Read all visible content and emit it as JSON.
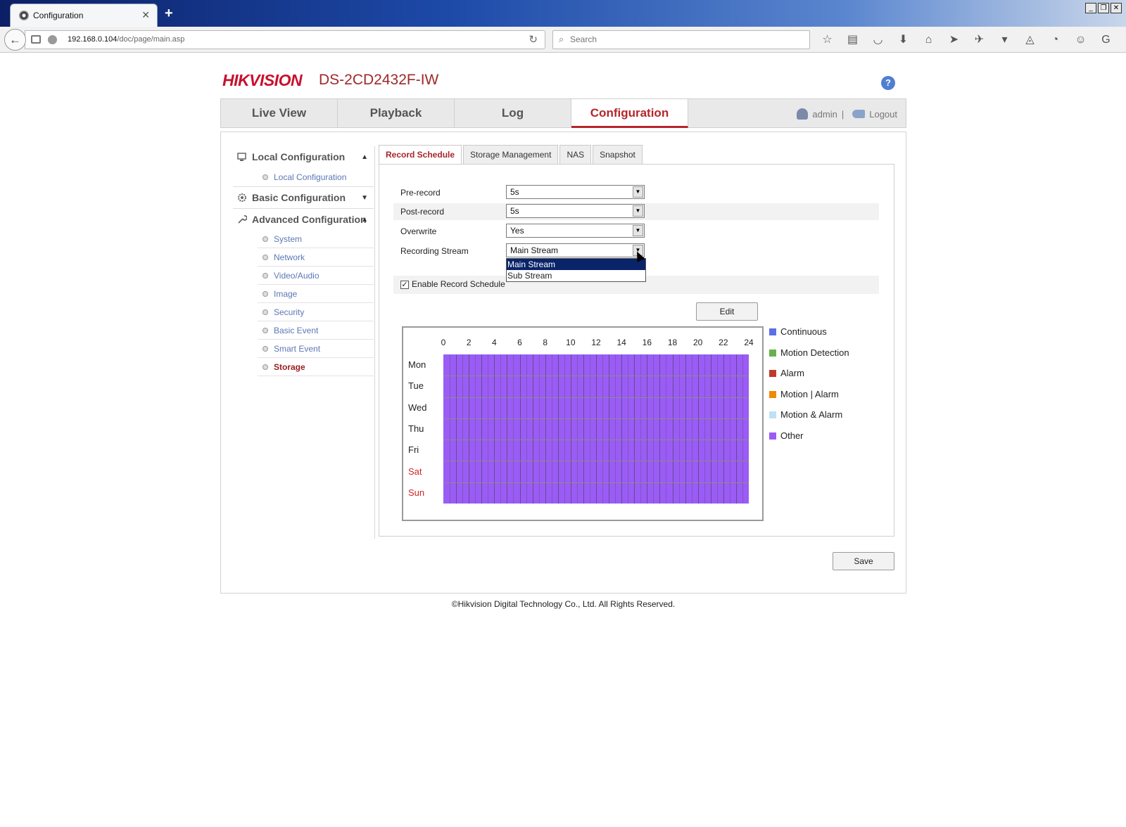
{
  "browser": {
    "tab_title": "Configuration",
    "url_host": "192.168.0.104",
    "url_path": "/doc/page/main.asp",
    "search_placeholder": "Search"
  },
  "app": {
    "logo": "HIKVISION",
    "model": "DS-2CD2432F-IW",
    "help_label": "?"
  },
  "main_nav": {
    "tabs": [
      {
        "label": "Live View"
      },
      {
        "label": "Playback"
      },
      {
        "label": "Log"
      },
      {
        "label": "Configuration",
        "active": true
      }
    ],
    "user": "admin",
    "separator": "|",
    "logout": "Logout"
  },
  "sidebar": {
    "local_group": "Local Configuration",
    "local_items": [
      {
        "label": "Local Configuration"
      }
    ],
    "basic_group": "Basic Configuration",
    "advanced_group": "Advanced Configuration",
    "advanced_items": [
      {
        "label": "System"
      },
      {
        "label": "Network"
      },
      {
        "label": "Video/Audio"
      },
      {
        "label": "Image"
      },
      {
        "label": "Security"
      },
      {
        "label": "Basic Event"
      },
      {
        "label": "Smart Event"
      },
      {
        "label": "Storage",
        "active": true
      }
    ]
  },
  "sub_tabs": [
    {
      "label": "Record Schedule",
      "active": true
    },
    {
      "label": "Storage Management"
    },
    {
      "label": "NAS"
    },
    {
      "label": "Snapshot"
    }
  ],
  "form": {
    "pre_record_label": "Pre-record",
    "pre_record_value": "5s",
    "post_record_label": "Post-record",
    "post_record_value": "5s",
    "overwrite_label": "Overwrite",
    "overwrite_value": "Yes",
    "recording_stream_label": "Recording Stream",
    "recording_stream_value": "Main Stream",
    "recording_stream_options": [
      "Main Stream",
      "Sub Stream"
    ],
    "enable_record_schedule_label": "Enable Record Schedule",
    "enable_record_schedule_checked": true,
    "edit_label": "Edit",
    "save_label": "Save"
  },
  "schedule": {
    "hours": [
      "0",
      "2",
      "4",
      "6",
      "8",
      "10",
      "12",
      "14",
      "16",
      "18",
      "20",
      "22",
      "24"
    ],
    "days": [
      {
        "label": "Mon",
        "weekend": false
      },
      {
        "label": "Tue",
        "weekend": false
      },
      {
        "label": "Wed",
        "weekend": false
      },
      {
        "label": "Thu",
        "weekend": false
      },
      {
        "label": "Fri",
        "weekend": false
      },
      {
        "label": "Sat",
        "weekend": true
      },
      {
        "label": "Sun",
        "weekend": true
      }
    ],
    "fill_type": "Other",
    "fill_color": "#9a5cf5"
  },
  "legend": [
    {
      "label": "Continuous",
      "color": "#5b6fe8"
    },
    {
      "label": "Motion Detection",
      "color": "#6ab04c"
    },
    {
      "label": "Alarm",
      "color": "#c0392b"
    },
    {
      "label": "Motion | Alarm",
      "color": "#f08a00"
    },
    {
      "label": "Motion & Alarm",
      "color": "#bfe0f5"
    },
    {
      "label": "Other",
      "color": "#9a5cf5"
    }
  ],
  "footer": "©Hikvision Digital Technology Co., Ltd. All Rights Reserved.",
  "colors": {
    "brand": "#c8102e",
    "accent": "#b5252b"
  }
}
